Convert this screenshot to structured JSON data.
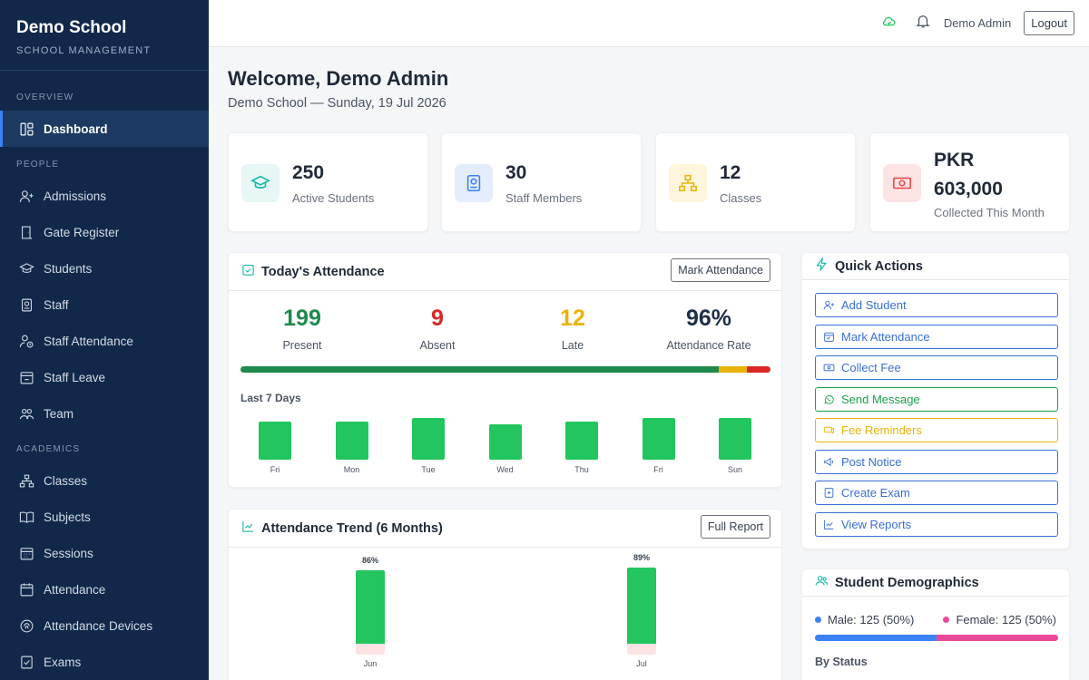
{
  "brand": {
    "title": "Demo School",
    "subtitle": "SCHOOL MANAGEMENT"
  },
  "sidebar": {
    "sections": {
      "overview": "OVERVIEW",
      "people": "PEOPLE",
      "academics": "ACADEMICS"
    },
    "items": {
      "dashboard": "Dashboard",
      "admissions": "Admissions",
      "gate_register": "Gate Register",
      "students": "Students",
      "staff": "Staff",
      "staff_attendance": "Staff Attendance",
      "staff_leave": "Staff Leave",
      "team": "Team",
      "classes": "Classes",
      "subjects": "Subjects",
      "sessions": "Sessions",
      "attendance": "Attendance",
      "attendance_devices": "Attendance Devices",
      "exams": "Exams"
    }
  },
  "topbar": {
    "user_name": "Demo Admin",
    "logout_label": "Logout"
  },
  "header": {
    "welcome": "Welcome, Demo Admin",
    "date": "Demo School — Sunday, 19 Jul 2026"
  },
  "stats": [
    {
      "value": "250",
      "label": "Active Students",
      "icon": "graduation-cap-icon",
      "color": "#14b8a6",
      "bg": "#e6f7f5"
    },
    {
      "value": "30",
      "label": "Staff Members",
      "icon": "id-badge-icon",
      "color": "#3b82f6",
      "bg": "#e3edfc"
    },
    {
      "value": "12",
      "label": "Classes",
      "icon": "hierarchy-icon",
      "color": "#eab308",
      "bg": "#fdf6dc"
    },
    {
      "value": "PKR 603,000",
      "value_line1": "PKR",
      "value_line2": "603,000",
      "label": "Collected This Month",
      "icon": "money-icon",
      "color": "#ef4444",
      "bg": "#fde4e4"
    }
  ],
  "attendance": {
    "title": "Today's Attendance",
    "button": "Mark Attendance",
    "present": "199",
    "present_label": "Present",
    "absent": "9",
    "absent_label": "Absent",
    "late": "12",
    "late_label": "Late",
    "rate": "96%",
    "rate_label": "Attendance Rate",
    "bar_fractions": {
      "present": 0.903,
      "late": 0.052,
      "absent": 0.045
    },
    "last7_label": "Last 7 Days",
    "days": [
      {
        "label": "Fri",
        "value": 0.92
      },
      {
        "label": "Mon",
        "value": 0.92
      },
      {
        "label": "Tue",
        "value": 1.0
      },
      {
        "label": "Wed",
        "value": 0.85
      },
      {
        "label": "Thu",
        "value": 0.92
      },
      {
        "label": "Fri",
        "value": 1.0
      },
      {
        "label": "Sun",
        "value": 1.0
      }
    ]
  },
  "trend": {
    "title": "Attendance Trend (6 Months)",
    "button": "Full Report",
    "months": [
      {
        "label": "Jun",
        "value": 86,
        "pct_label": "86%"
      },
      {
        "label": "Jul",
        "value": 89,
        "pct_label": "89%"
      }
    ]
  },
  "quick_actions": {
    "title": "Quick Actions",
    "items": [
      {
        "label": "Add Student",
        "icon": "add-user-icon",
        "color": "#3b6fd8"
      },
      {
        "label": "Mark Attendance",
        "icon": "calendar-icon",
        "color": "#3b6fd8"
      },
      {
        "label": "Collect Fee",
        "icon": "cash-icon",
        "color": "#3b6fd8"
      },
      {
        "label": "Send Message",
        "icon": "whatsapp-icon",
        "color": "#16a34a"
      },
      {
        "label": "Fee Reminders",
        "icon": "reminder-icon",
        "color": "#eab308"
      },
      {
        "label": "Post Notice",
        "icon": "megaphone-icon",
        "color": "#3b6fd8"
      },
      {
        "label": "Create Exam",
        "icon": "exam-icon",
        "color": "#3b6fd8"
      },
      {
        "label": "View Reports",
        "icon": "chart-line-icon",
        "color": "#3b6fd8"
      }
    ]
  },
  "demographics": {
    "title": "Student Demographics",
    "male": "Male: 125 (50%)",
    "female": "Female: 125 (50%)",
    "male_fraction": 0.5,
    "by_status": "By Status"
  },
  "colors": {
    "green": "#1e8a4c",
    "red": "#dc2626",
    "yellow": "#eab308",
    "navy": "#1e2f4a",
    "male": "#3b82f6",
    "female": "#ec4899"
  }
}
